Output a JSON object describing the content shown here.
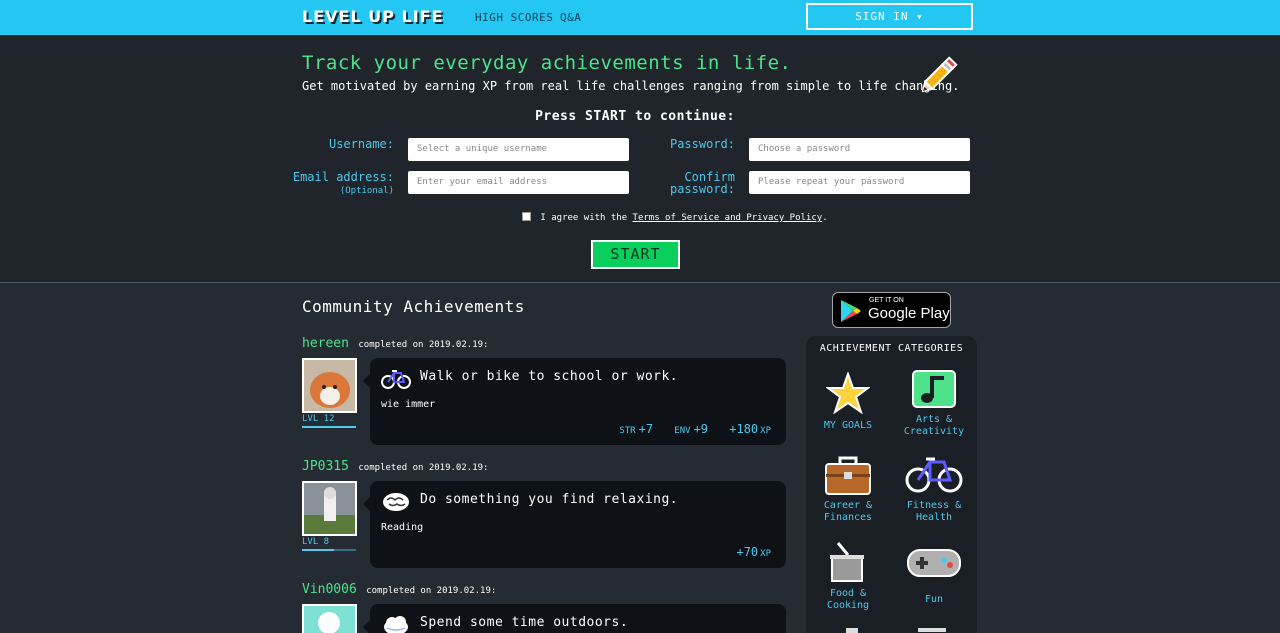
{
  "nav": {
    "logo": "LEVEL UP LIFE",
    "high_scores": "HIGH SCORES",
    "qa": "Q&A",
    "sign_in": "SIGN IN ▾"
  },
  "hero": {
    "tagline": "Track your everyday achievements in life.",
    "subtagline": "Get motivated by earning XP from real life challenges ranging from simple to life changing.",
    "press_start": "Press START to continue:",
    "username_label": "Username:",
    "username_placeholder": "Select a unique username",
    "email_label": "Email address:",
    "email_optional": "(Optional)",
    "email_placeholder": "Enter your email address",
    "password_label": "Password:",
    "password_placeholder": "Choose a password",
    "confirm_label_1": "Confirm",
    "confirm_label_2": "password:",
    "confirm_placeholder": "Please repeat your password",
    "agree_text": "I agree with the",
    "terms_link": "Terms of Service and Privacy Policy",
    "agree_end": ".",
    "start": "START"
  },
  "community": {
    "title": "Community Achievements",
    "completed_text": "completed on",
    "items": [
      {
        "user": "hereen",
        "date": "2019.02.19:",
        "level": "LVL 12",
        "level_progress": 1.0,
        "icon": "bicycle-icon",
        "title": "Walk or bike to school or work.",
        "note": "wie immer",
        "stats": [
          {
            "label": "STR",
            "value": "+7"
          },
          {
            "label": "ENV",
            "value": "+9"
          }
        ],
        "xp": "+180",
        "xp_label": "XP"
      },
      {
        "user": "JP0315",
        "date": "2019.02.19:",
        "level": "LVL 8",
        "level_progress": 0.6,
        "icon": "brain-icon",
        "title": "Do something you find relaxing.",
        "note": "Reading",
        "stats": [],
        "xp": "+70",
        "xp_label": "XP"
      },
      {
        "user": "Vin0006",
        "date": "2019.02.19:",
        "level": "",
        "icon": "cloud-icon",
        "title": "Spend some time outdoors.",
        "note": "",
        "stats": [],
        "xp": "",
        "xp_label": ""
      }
    ]
  },
  "google_play": {
    "get_it_on": "GET IT ON",
    "store": "Google Play"
  },
  "categories": {
    "title": "ACHIEVEMENT CATEGORIES",
    "items": [
      {
        "label": "MY GOALS",
        "icon": "star-icon",
        "color": "#ffd23f"
      },
      {
        "label_1": "Arts &",
        "label_2": "Creativity",
        "icon": "music-note-icon",
        "color": "#4ee38a"
      },
      {
        "label_1": "Career &",
        "label_2": "Finances",
        "icon": "briefcase-icon",
        "color": "#b8692a"
      },
      {
        "label_1": "Fitness &",
        "label_2": "Health",
        "icon": "bicycle-icon",
        "color": "#ffffff"
      },
      {
        "label_1": "Food &",
        "label_2": "Cooking",
        "icon": "cooking-pot-icon",
        "color": "#9a9a9a"
      },
      {
        "label": "Fun",
        "icon": "gamepad-icon",
        "color": "#b0b0b0"
      }
    ]
  },
  "colors": {
    "nav_bg": "#23c7f2",
    "accent_green": "#4ee38a",
    "accent_blue": "#4fc7ee",
    "start_button": "#0acf5d"
  }
}
